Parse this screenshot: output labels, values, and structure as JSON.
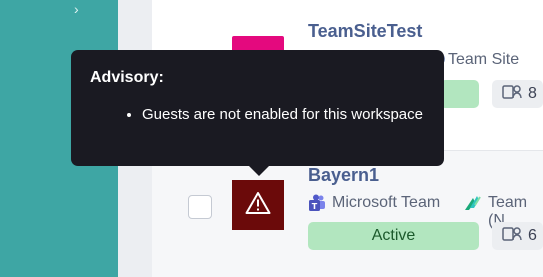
{
  "sidebar": {
    "expand_icon": "chevron-right-icon"
  },
  "workspaces": [
    {
      "name": "TeamSiteTest",
      "type_label": "Team Site",
      "type_icon": "sharepoint-icon",
      "member_count": "8",
      "tile_color": "#e4097e"
    },
    {
      "name": "Bayern1",
      "type_label": "Microsoft Team",
      "type_icon": "teams-icon",
      "template_label": "Team (N",
      "template_icon": "template-icon",
      "status": "Active",
      "member_count": "6",
      "tile_color": "#6b0a0a",
      "tile_icon": "warning-icon"
    }
  ],
  "tooltip": {
    "title": "Advisory:",
    "items": [
      "Guests are not enabled for this workspace"
    ]
  },
  "colors": {
    "sidebar": "#3ea6a4",
    "active_pill": "#b2e6bf",
    "tooltip_bg": "#1a1a22",
    "title_text": "#4a5f8f"
  }
}
